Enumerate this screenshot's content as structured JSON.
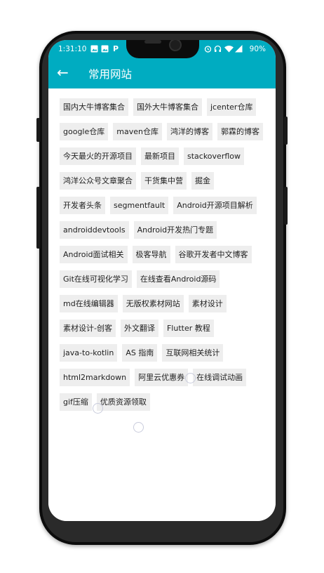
{
  "status_bar": {
    "time": "1:31:10",
    "icons_left": [
      "image-icon",
      "image-icon",
      "p-icon"
    ],
    "p_glyph": "P",
    "icons_right": [
      "alarm-icon",
      "headset-icon",
      "wifi-icon",
      "signal-icon"
    ],
    "battery": "90%"
  },
  "app_bar": {
    "title": "常用网站",
    "back_icon": "arrow-back-icon",
    "back_glyph": "←",
    "color": "#00acc1"
  },
  "sites": [
    "国内大牛博客集合",
    "国外大牛博客集合",
    "jcenter仓库",
    "google仓库",
    "maven仓库",
    "鸿洋的博客",
    "郭霖的博客",
    "今天最火的开源项目",
    "最新项目",
    "stackoverflow",
    "鸿洋公众号文章聚合",
    "干货集中营",
    "掘金",
    "开发者头条",
    "segmentfault",
    "Android开源项目解析",
    "androiddevtools",
    "Android开发热门专题",
    "Android面试相关",
    "极客导航",
    "谷歌开发者中文博客",
    "Git在线可视化学习",
    "在线查看Android源码",
    "md在线编辑器",
    "无版权素材网站",
    "素材设计",
    "素材设计-创客",
    "外文翻译",
    "Flutter 教程",
    "java-to-kotlin",
    "AS 指南",
    "互联网相关统计",
    "html2markdown",
    "阿里云优惠券",
    "在线调试动画",
    "gif压缩",
    "优质资源领取"
  ]
}
